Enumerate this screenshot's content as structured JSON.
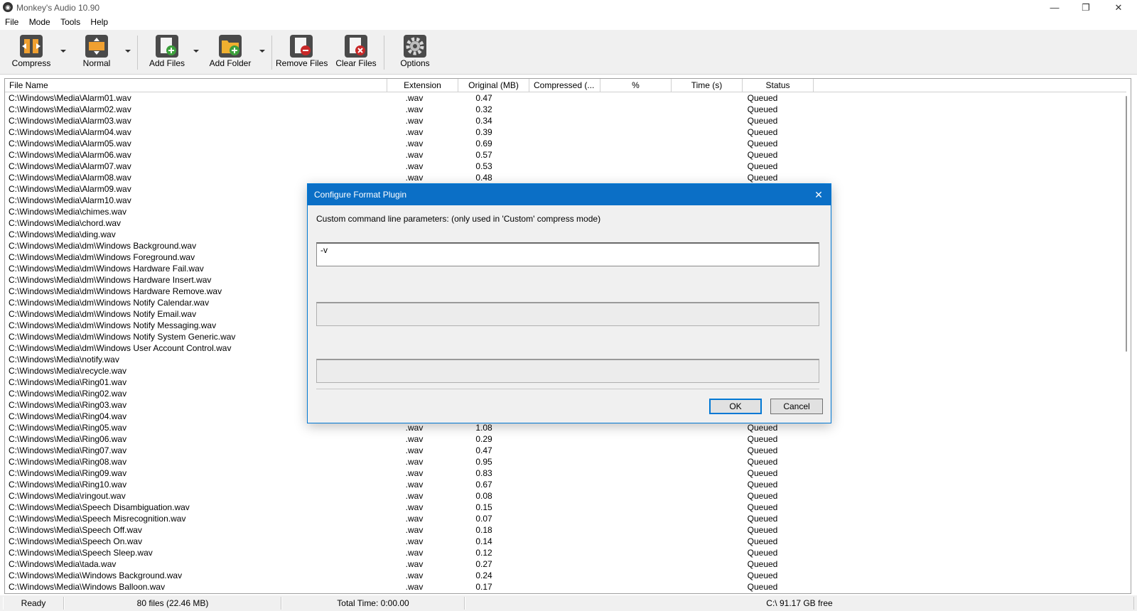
{
  "window": {
    "title": "Monkey's Audio 10.90",
    "app_icon": "monkey-icon",
    "controls": [
      "minimize-icon",
      "restore-icon",
      "close-icon"
    ]
  },
  "menu": [
    "File",
    "Mode",
    "Tools",
    "Help"
  ],
  "toolbar": {
    "compress": "Compress",
    "normal": "Normal",
    "add_files": "Add Files",
    "add_folder": "Add Folder",
    "remove_files": "Remove Files",
    "clear_files": "Clear Files",
    "options": "Options"
  },
  "columns": [
    "File Name",
    "Extension",
    "Original (MB)",
    "Compressed (...",
    "%",
    "Time (s)",
    "Status"
  ],
  "files": [
    {
      "name": "C:\\Windows\\Media\\Alarm01.wav",
      "ext": ".wav",
      "orig": "0.47",
      "status": "Queued"
    },
    {
      "name": "C:\\Windows\\Media\\Alarm02.wav",
      "ext": ".wav",
      "orig": "0.32",
      "status": "Queued"
    },
    {
      "name": "C:\\Windows\\Media\\Alarm03.wav",
      "ext": ".wav",
      "orig": "0.34",
      "status": "Queued"
    },
    {
      "name": "C:\\Windows\\Media\\Alarm04.wav",
      "ext": ".wav",
      "orig": "0.39",
      "status": "Queued"
    },
    {
      "name": "C:\\Windows\\Media\\Alarm05.wav",
      "ext": ".wav",
      "orig": "0.69",
      "status": "Queued"
    },
    {
      "name": "C:\\Windows\\Media\\Alarm06.wav",
      "ext": ".wav",
      "orig": "0.57",
      "status": "Queued"
    },
    {
      "name": "C:\\Windows\\Media\\Alarm07.wav",
      "ext": ".wav",
      "orig": "0.53",
      "status": "Queued"
    },
    {
      "name": "C:\\Windows\\Media\\Alarm08.wav",
      "ext": ".wav",
      "orig": "0.48",
      "status": "Queued"
    },
    {
      "name": "C:\\Windows\\Media\\Alarm09.wav",
      "ext": "",
      "orig": "",
      "status": ""
    },
    {
      "name": "C:\\Windows\\Media\\Alarm10.wav",
      "ext": "",
      "orig": "",
      "status": ""
    },
    {
      "name": "C:\\Windows\\Media\\chimes.wav",
      "ext": "",
      "orig": "",
      "status": ""
    },
    {
      "name": "C:\\Windows\\Media\\chord.wav",
      "ext": "",
      "orig": "",
      "status": ""
    },
    {
      "name": "C:\\Windows\\Media\\ding.wav",
      "ext": "",
      "orig": "",
      "status": ""
    },
    {
      "name": "C:\\Windows\\Media\\dm\\Windows Background.wav",
      "ext": "",
      "orig": "",
      "status": ""
    },
    {
      "name": "C:\\Windows\\Media\\dm\\Windows Foreground.wav",
      "ext": "",
      "orig": "",
      "status": ""
    },
    {
      "name": "C:\\Windows\\Media\\dm\\Windows Hardware Fail.wav",
      "ext": "",
      "orig": "",
      "status": ""
    },
    {
      "name": "C:\\Windows\\Media\\dm\\Windows Hardware Insert.wav",
      "ext": "",
      "orig": "",
      "status": ""
    },
    {
      "name": "C:\\Windows\\Media\\dm\\Windows Hardware Remove.wav",
      "ext": "",
      "orig": "",
      "status": ""
    },
    {
      "name": "C:\\Windows\\Media\\dm\\Windows Notify Calendar.wav",
      "ext": "",
      "orig": "",
      "status": ""
    },
    {
      "name": "C:\\Windows\\Media\\dm\\Windows Notify Email.wav",
      "ext": "",
      "orig": "",
      "status": ""
    },
    {
      "name": "C:\\Windows\\Media\\dm\\Windows Notify Messaging.wav",
      "ext": "",
      "orig": "",
      "status": ""
    },
    {
      "name": "C:\\Windows\\Media\\dm\\Windows Notify System Generic.wav",
      "ext": "",
      "orig": "",
      "status": ""
    },
    {
      "name": "C:\\Windows\\Media\\dm\\Windows User Account Control.wav",
      "ext": "",
      "orig": "",
      "status": ""
    },
    {
      "name": "C:\\Windows\\Media\\notify.wav",
      "ext": "",
      "orig": "",
      "status": ""
    },
    {
      "name": "C:\\Windows\\Media\\recycle.wav",
      "ext": "",
      "orig": "",
      "status": ""
    },
    {
      "name": "C:\\Windows\\Media\\Ring01.wav",
      "ext": "",
      "orig": "",
      "status": ""
    },
    {
      "name": "C:\\Windows\\Media\\Ring02.wav",
      "ext": "",
      "orig": "",
      "status": ""
    },
    {
      "name": "C:\\Windows\\Media\\Ring03.wav",
      "ext": "",
      "orig": "",
      "status": ""
    },
    {
      "name": "C:\\Windows\\Media\\Ring04.wav",
      "ext": "",
      "orig": "",
      "status": ""
    },
    {
      "name": "C:\\Windows\\Media\\Ring05.wav",
      "ext": ".wav",
      "orig": "1.08",
      "status": "Queued"
    },
    {
      "name": "C:\\Windows\\Media\\Ring06.wav",
      "ext": ".wav",
      "orig": "0.29",
      "status": "Queued"
    },
    {
      "name": "C:\\Windows\\Media\\Ring07.wav",
      "ext": ".wav",
      "orig": "0.47",
      "status": "Queued"
    },
    {
      "name": "C:\\Windows\\Media\\Ring08.wav",
      "ext": ".wav",
      "orig": "0.95",
      "status": "Queued"
    },
    {
      "name": "C:\\Windows\\Media\\Ring09.wav",
      "ext": ".wav",
      "orig": "0.83",
      "status": "Queued"
    },
    {
      "name": "C:\\Windows\\Media\\Ring10.wav",
      "ext": ".wav",
      "orig": "0.67",
      "status": "Queued"
    },
    {
      "name": "C:\\Windows\\Media\\ringout.wav",
      "ext": ".wav",
      "orig": "0.08",
      "status": "Queued"
    },
    {
      "name": "C:\\Windows\\Media\\Speech Disambiguation.wav",
      "ext": ".wav",
      "orig": "0.15",
      "status": "Queued"
    },
    {
      "name": "C:\\Windows\\Media\\Speech Misrecognition.wav",
      "ext": ".wav",
      "orig": "0.07",
      "status": "Queued"
    },
    {
      "name": "C:\\Windows\\Media\\Speech Off.wav",
      "ext": ".wav",
      "orig": "0.18",
      "status": "Queued"
    },
    {
      "name": "C:\\Windows\\Media\\Speech On.wav",
      "ext": ".wav",
      "orig": "0.14",
      "status": "Queued"
    },
    {
      "name": "C:\\Windows\\Media\\Speech Sleep.wav",
      "ext": ".wav",
      "orig": "0.12",
      "status": "Queued"
    },
    {
      "name": "C:\\Windows\\Media\\tada.wav",
      "ext": ".wav",
      "orig": "0.27",
      "status": "Queued"
    },
    {
      "name": "C:\\Windows\\Media\\Windows Background.wav",
      "ext": ".wav",
      "orig": "0.24",
      "status": "Queued"
    },
    {
      "name": "C:\\Windows\\Media\\Windows Balloon.wav",
      "ext": ".wav",
      "orig": "0.17",
      "status": "Queued"
    }
  ],
  "statusbar": {
    "state": "Ready",
    "files": "80 files (22.46 MB)",
    "total_time": "Total Time: 0:00.00",
    "free_space": "C:\\ 91.17 GB free"
  },
  "dialog": {
    "title": "Configure Format Plugin",
    "label": "Custom command line parameters: (only used in 'Custom' compress mode)",
    "param_value": "-v",
    "ok": "OK",
    "cancel": "Cancel"
  },
  "colors": {
    "dialog_title_bg": "#0b6fc6",
    "toolbar_bg": "#f0f0f0"
  }
}
